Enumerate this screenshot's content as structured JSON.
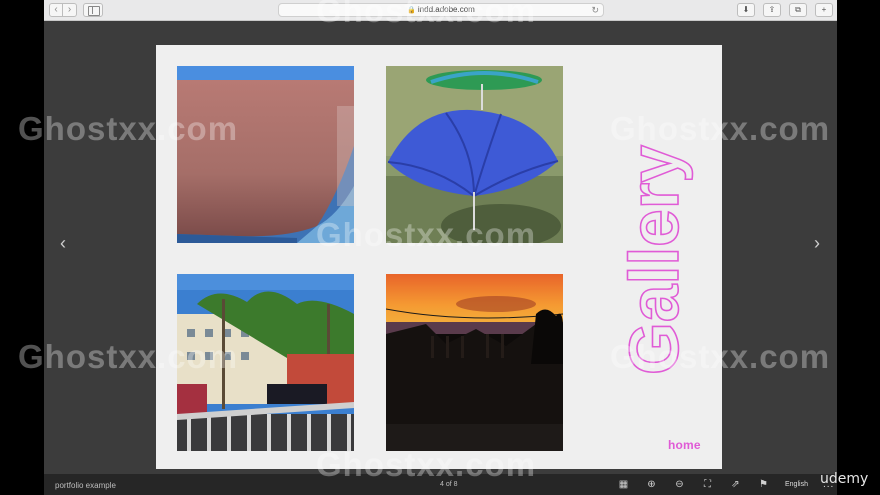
{
  "browser": {
    "url": "indd.adobe.com",
    "back_label": "‹",
    "forward_label": "›"
  },
  "viewer": {
    "prev_arrow": "‹",
    "next_arrow": "›"
  },
  "page": {
    "title": "Gallery",
    "home_label": "home",
    "accent_color": "#e05bd6",
    "photos": [
      {
        "name": "drink-photo"
      },
      {
        "name": "umbrellas-photo"
      },
      {
        "name": "palm-street-photo"
      },
      {
        "name": "sunset-photo"
      }
    ]
  },
  "toolbar": {
    "doc_title": "portfolio example",
    "page_count": "4 of 8",
    "language": "English",
    "more": "..."
  },
  "branding": {
    "udemy": "udemy",
    "watermark": "Ghostxx.com"
  }
}
